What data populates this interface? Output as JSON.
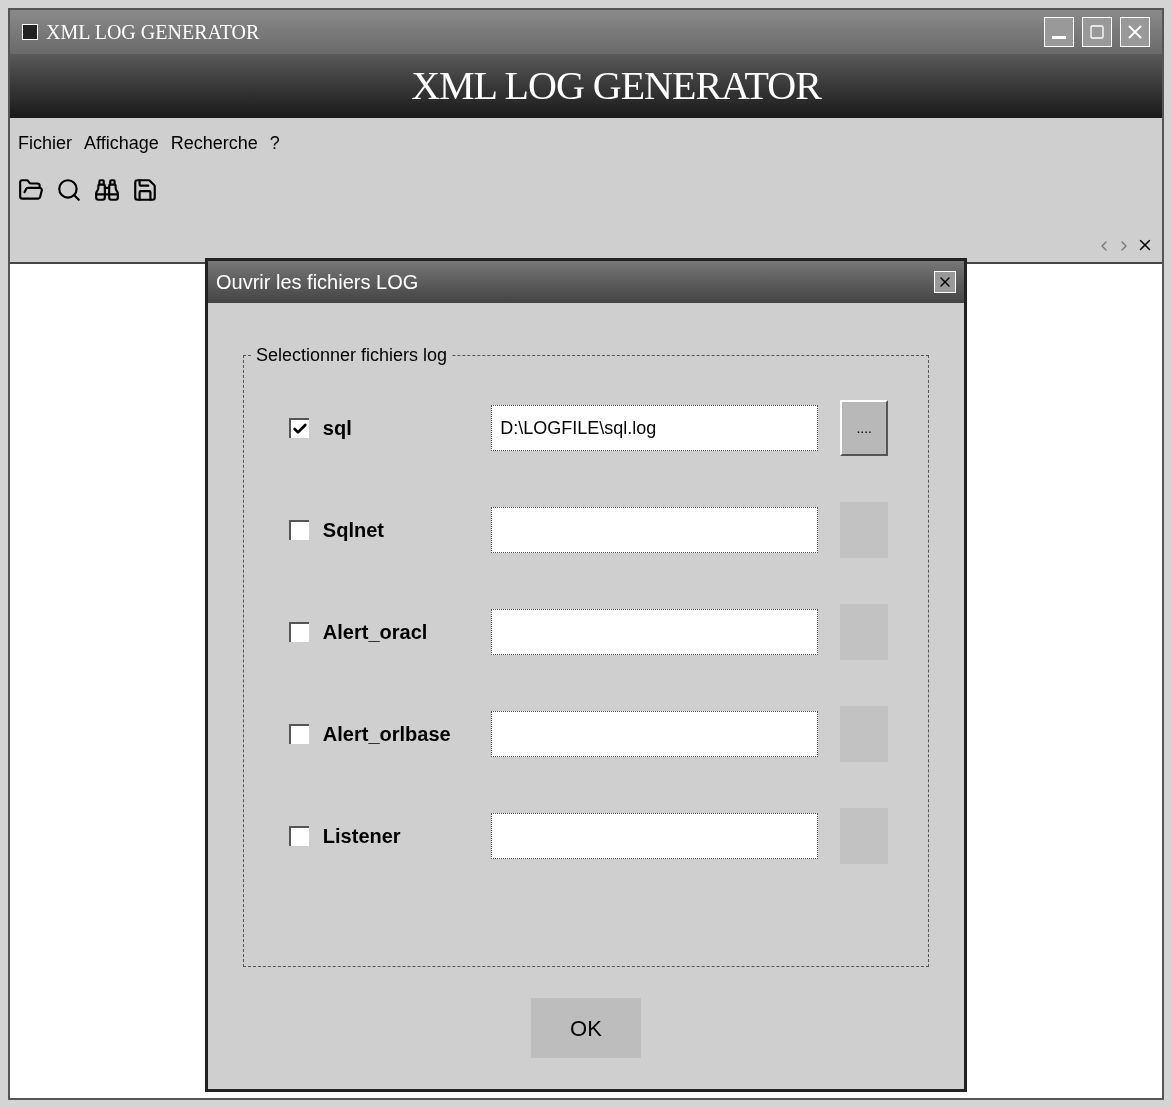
{
  "window": {
    "title": "XML LOG GENERATOR"
  },
  "banner": {
    "title": "XML LOG GENERATOR"
  },
  "menu": [
    "Fichier",
    "Affichage",
    "Recherche",
    "?"
  ],
  "dialog": {
    "title": "Ouvrir les fichiers LOG",
    "group_label": "Selectionner fichiers log",
    "files": [
      {
        "label": "sql",
        "checked": true,
        "value": "D:\\LOGFILE\\sql.log",
        "button_label": "....",
        "enabled": true
      },
      {
        "label": "Sqlnet",
        "checked": false,
        "enabled": false
      },
      {
        "label": "Alert_oracl",
        "checked": false,
        "enabled": false
      },
      {
        "label": "Alert_orlbase",
        "checked": false,
        "enabled": false
      },
      {
        "label": "Listener",
        "checked": false,
        "enabled": false
      }
    ],
    "ok_button": "OK"
  }
}
